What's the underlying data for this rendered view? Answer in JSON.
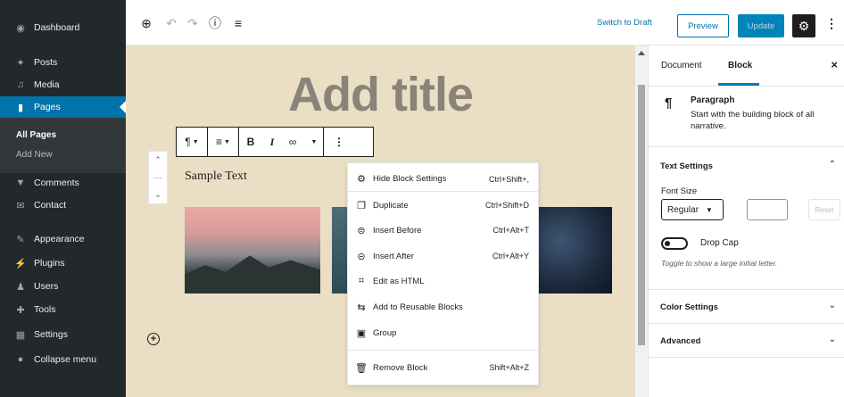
{
  "admin_menu": {
    "dashboard": "Dashboard",
    "posts": "Posts",
    "media": "Media",
    "pages": "Pages",
    "all_pages": "All Pages",
    "add_new": "Add New",
    "comments": "Comments",
    "contact": "Contact",
    "appearance": "Appearance",
    "plugins": "Plugins",
    "users": "Users",
    "tools": "Tools",
    "settings": "Settings",
    "collapse": "Collapse menu"
  },
  "header": {
    "switch_to_draft": "Switch to Draft",
    "preview": "Preview",
    "update": "Update"
  },
  "editor": {
    "title_placeholder": "Add title",
    "paragraph_text": "Sample Text"
  },
  "block_toolbar": {
    "bold": "B",
    "italic": "I"
  },
  "block_menu": {
    "items": [
      {
        "label": "Hide Block Settings",
        "shortcut": "Ctrl+Shift+,"
      },
      {
        "label": "Duplicate",
        "shortcut": "Ctrl+Shift+D"
      },
      {
        "label": "Insert Before",
        "shortcut": "Ctrl+Alt+T"
      },
      {
        "label": "Insert After",
        "shortcut": "Ctrl+Alt+Y"
      },
      {
        "label": "Edit as HTML",
        "shortcut": ""
      },
      {
        "label": "Add to Reusable Blocks",
        "shortcut": ""
      },
      {
        "label": "Group",
        "shortcut": ""
      },
      {
        "label": "Remove Block",
        "shortcut": "Shift+Alt+Z"
      }
    ]
  },
  "settings_sidebar": {
    "tab_document": "Document",
    "tab_block": "Block",
    "block_name": "Paragraph",
    "block_description": "Start with the building block of all narrative.",
    "text_settings": "Text Settings",
    "font_size_label": "Font Size",
    "font_size_value": "Regular",
    "reset": "Reset",
    "drop_cap": "Drop Cap",
    "drop_cap_help": "Toggle to show a large initial letter.",
    "color_settings": "Color Settings",
    "advanced": "Advanced"
  },
  "colors": {
    "admin_sidebar": "#23282d",
    "admin_active": "#0073aa",
    "canvas_bg": "#eadfc4",
    "primary_button": "#0085ba"
  }
}
